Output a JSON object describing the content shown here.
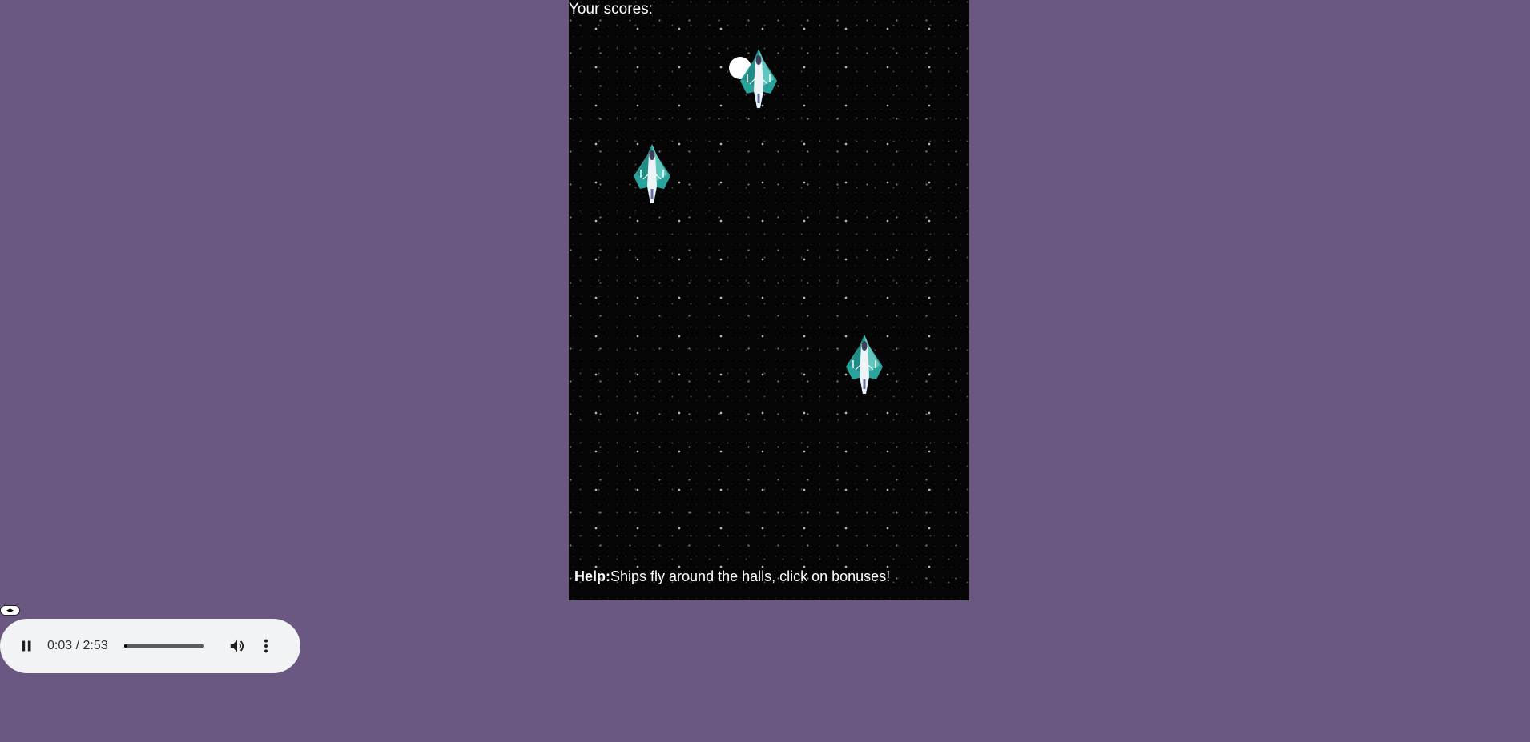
{
  "game": {
    "score_label": "Your scores:",
    "help_label": "Help:",
    "help_text": "Ships fly around the halls, click on bonuses!",
    "ship_icon": "spaceship-icon",
    "bonus_icon": "bonus-orb-icon"
  },
  "audio": {
    "time": "0:03 / 2:53",
    "progress": 0.017,
    "state": "playing",
    "icons": {
      "pause": "pause-icon",
      "volume": "volume-icon",
      "more": "more-vert-icon",
      "handle": "drag-handle-icon"
    }
  },
  "colors": {
    "page_background": "#6a5882",
    "game_background": "#050505",
    "ship_hull": "#2aa8a0",
    "player_background": "#f1f3f4"
  }
}
